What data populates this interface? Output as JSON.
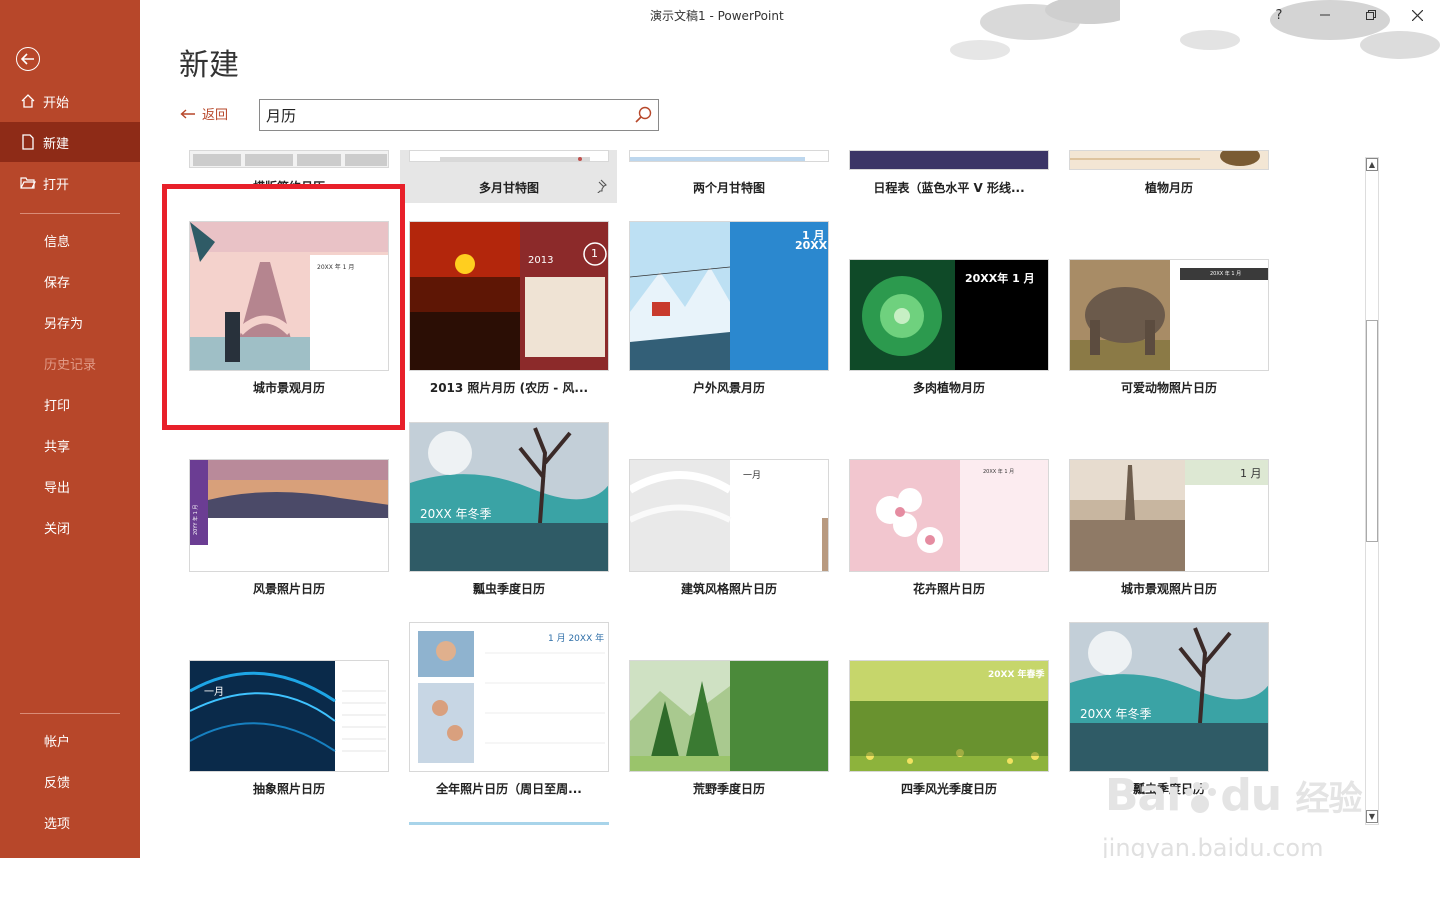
{
  "window": {
    "title": "演示文稿1  -  PowerPoint",
    "help": "?"
  },
  "sidebar": {
    "items": [
      {
        "label": "开始"
      },
      {
        "label": "新建"
      },
      {
        "label": "打开"
      },
      {
        "label": "信息"
      },
      {
        "label": "保存"
      },
      {
        "label": "另存为"
      },
      {
        "label": "历史记录"
      },
      {
        "label": "打印"
      },
      {
        "label": "共享"
      },
      {
        "label": "导出"
      },
      {
        "label": "关闭"
      },
      {
        "label": "帐户"
      },
      {
        "label": "反馈"
      },
      {
        "label": "选项"
      }
    ]
  },
  "page": {
    "title": "新建",
    "back_label": "返回"
  },
  "search": {
    "value": "月历"
  },
  "templates": {
    "row0": [
      {
        "label": "横版简约月历"
      },
      {
        "label": "多月甘特图"
      },
      {
        "label": "两个月甘特图"
      },
      {
        "label": "日程表（蓝色水平 V 形线..."
      },
      {
        "label": "植物月历"
      }
    ],
    "row1": [
      {
        "label": "城市景观月历"
      },
      {
        "label": "2013 照片月历 (农历 - 风..."
      },
      {
        "label": "户外风景月历"
      },
      {
        "label": "多肉植物月历"
      },
      {
        "label": "可爱动物照片日历"
      }
    ],
    "row2": [
      {
        "label": "风景照片日历"
      },
      {
        "label": "瓢虫季度日历"
      },
      {
        "label": "建筑风格照片日历"
      },
      {
        "label": "花卉照片日历"
      },
      {
        "label": "城市景观照片日历"
      }
    ],
    "row3": [
      {
        "label": "抽象照片日历"
      },
      {
        "label": "全年照片日历（周日至周..."
      },
      {
        "label": "荒野季度日历"
      },
      {
        "label": "四季风光季度日历"
      },
      {
        "label": "瓢虫季度日历"
      }
    ]
  },
  "thumb_text": {
    "city_month": "20XX 年 1 月",
    "photo2013_year": "2013",
    "photo2013_day": "1",
    "outdoor_month": "1 月",
    "outdoor_year": "20XX",
    "succulent": "20XX年 1 月",
    "animal": "20XX 年 1 月",
    "landscape_side": "20YY 年 1 月",
    "ladybug_banner": "20XX 年冬季",
    "arch_month": "一月",
    "flower": "20XX 年 1 月",
    "cityphoto_month": "1 月",
    "abstract_month": "一月",
    "fullyear": "1 月 20XX 年",
    "seasons": "20XX 年春季"
  },
  "watermark": {
    "brand": "Bai",
    "brand2": "du",
    "jingyan": "经验",
    "url": "jingyan.baidu.com"
  },
  "colors": {
    "sidebar": "#b7472a",
    "sidebar_active": "#8e2b17",
    "highlight": "#e8202a"
  }
}
